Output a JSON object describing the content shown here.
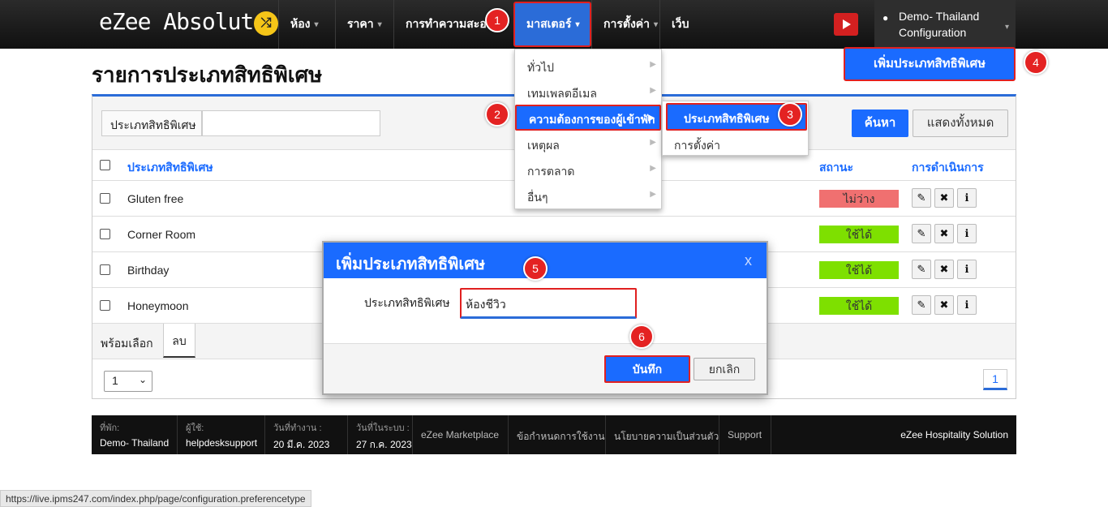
{
  "header": {
    "logo_text": "eZee Absolute",
    "logo_badge": "⤮",
    "nav": [
      {
        "label": "ห้อง",
        "caret": "▾"
      },
      {
        "label": "ราคา",
        "caret": "▾"
      },
      {
        "label": "การทำความสะอาด",
        "caret": ""
      },
      {
        "label": "มาสเตอร์",
        "caret": "▾"
      },
      {
        "label": "การตั้งค่า",
        "caret": "▾"
      },
      {
        "label": "เว็บ",
        "caret": ""
      }
    ],
    "user_line1": "Demo- Thailand",
    "user_line2": "Configuration"
  },
  "markers": [
    "1",
    "2",
    "3",
    "4",
    "5",
    "6"
  ],
  "page_title": "รายการประเภทสิทธิพิเศษ",
  "add_button": "เพิ่มประเภทสิทธิพิเศษ",
  "filter": {
    "label": "ประเภทสิทธิพิเศษ",
    "value": "",
    "search_button": "ค้นหา",
    "show_all_button": "แสดงทั้งหมด"
  },
  "table": {
    "headers": {
      "name": "ประเภทสิทธิพิเศษ",
      "status": "สถานะ",
      "actions": "การดำเนินการ"
    },
    "rows": [
      {
        "name": "Gluten free",
        "status": "ไม่ว่าง",
        "status_color": "#f07070"
      },
      {
        "name": "Corner Room",
        "status": "ใช้ได้",
        "status_color": "#7ee000"
      },
      {
        "name": "Birthday",
        "status": "ใช้ได้",
        "status_color": "#7ee000"
      },
      {
        "name": "Honeymoon",
        "status": "ใช้ได้",
        "status_color": "#7ee000"
      }
    ],
    "action_icons": [
      "pencil-icon",
      "close-icon",
      "info-icon"
    ],
    "ready_select": "พร้อมเลือก",
    "delete_tab": "ลบ",
    "page_size": "1",
    "current_page": "1"
  },
  "master_menu": {
    "items": [
      "ทั่วไป",
      "เทมเพลตอีเมล",
      "ความต้องการของผู้เข้าพัก",
      "เหตุผล",
      "การตลาด",
      "อื่นๆ"
    ],
    "highlighted_index": 2,
    "submenu": [
      "ประเภทสิทธิพิเศษ",
      "การตั้งค่า"
    ]
  },
  "modal": {
    "title": "เพิ่มประเภทสิทธิพิเศษ",
    "close": "x",
    "field_label": "ประเภทสิทธิพิเศษ",
    "field_value": "ห้องชีวิว",
    "save_button": "บันทึก",
    "cancel_button": "ยกเลิก"
  },
  "bottombar": {
    "property_caption": "ที่พัก:",
    "property_value": "Demo- Thailand",
    "user_caption": "ผู้ใช้:",
    "user_value": "helpdesksupport",
    "workday_caption": "วันที่ทำงาน :",
    "workday_value": "20 มี.ค. 2023",
    "sysdate_caption": "วันที่ในระบบ :",
    "sysdate_value": "27 ก.ค. 2023",
    "links": [
      "eZee Marketplace",
      "ข้อกำหนดการใช้งาน",
      "นโยบายความเป็นส่วนตัว",
      "Support"
    ],
    "brand": "eZee Hospitality Solution"
  },
  "status_url": "https://live.ipms247.com/index.php/page/configuration.preferencetype",
  "colors": {
    "accent": "#1a6bff",
    "highlight_border": "#e02020",
    "topbar": "#1a1a1a"
  }
}
